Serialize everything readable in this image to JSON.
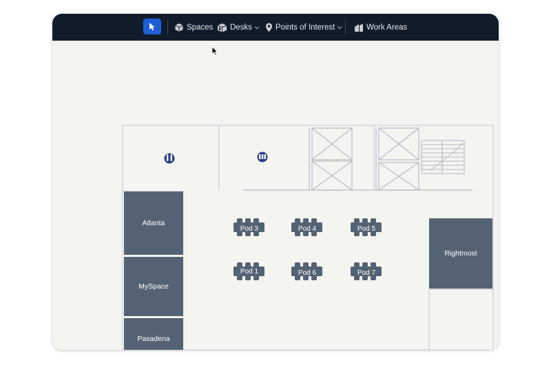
{
  "toolbar": {
    "items": [
      {
        "label": "Spaces",
        "icon": "cube-icon"
      },
      {
        "label": "Desks",
        "icon": "desk-icon",
        "has_dropdown": true
      },
      {
        "label": "Points of Interest",
        "icon": "map-pin-icon",
        "has_dropdown": true
      },
      {
        "label": "Work Areas",
        "icon": "work-areas-icon"
      }
    ],
    "active_tool": "select-tool"
  },
  "floorplan": {
    "rooms": [
      "Atlanta",
      "MySpace",
      "Pasadena",
      "Rightmost"
    ],
    "pods": [
      "Pod 3",
      "Pod 4",
      "Pod 5",
      "Pod 1",
      "Pod 6",
      "Pod 7"
    ],
    "poi_icons": [
      "restroom-icon",
      "cafe-icon"
    ]
  },
  "colors": {
    "toolbar_bg": "#111c2b",
    "accent": "#1f5fd6",
    "room_fill": "#546373",
    "canvas_bg": "#f3f3f0",
    "wall_line": "#b5bcc4"
  }
}
